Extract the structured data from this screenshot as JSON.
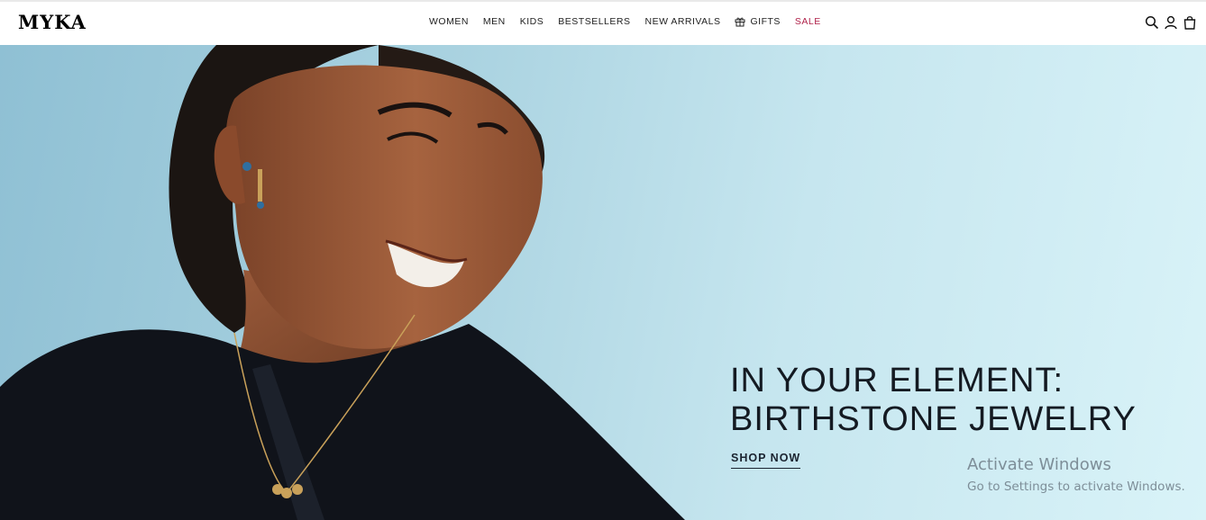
{
  "brand": {
    "logo_text": "MYKA"
  },
  "nav": {
    "items": [
      {
        "label": "WOMEN"
      },
      {
        "label": "MEN"
      },
      {
        "label": "KIDS"
      },
      {
        "label": "BESTSELLERS"
      },
      {
        "label": "NEW ARRIVALS"
      },
      {
        "label": "GIFTS",
        "icon": "gift-icon"
      },
      {
        "label": "SALE",
        "color": "#b0234b"
      }
    ]
  },
  "header_icons": [
    "search-icon",
    "account-icon",
    "bag-icon"
  ],
  "hero": {
    "headline_line1": "IN YOUR ELEMENT:",
    "headline_line2": "BIRTHSTONE JEWELRY",
    "cta_label": "SHOP NOW",
    "background_color": "#b9dce8"
  },
  "os_watermark": {
    "title": "Activate Windows",
    "subtitle": "Go to Settings to activate Windows."
  }
}
